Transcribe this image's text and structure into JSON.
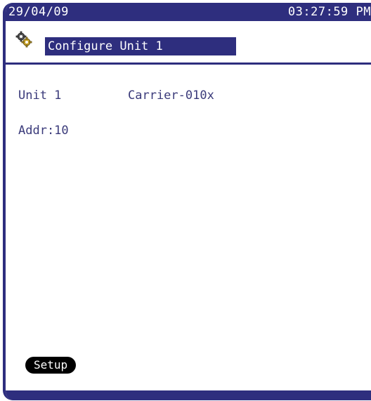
{
  "status_bar": {
    "date": "29/04/09",
    "time": "03:27:59 PM"
  },
  "header": {
    "icon": "gear-icon",
    "title": "Configure Unit 1"
  },
  "content": {
    "unit_label": "Unit 1",
    "unit_name": "Carrier-010x",
    "address": "Addr:10"
  },
  "footer": {
    "setup_label": "Setup"
  },
  "colors": {
    "accent": "#2e2e7e",
    "text": "#3a3a7a",
    "button": "#000000"
  }
}
